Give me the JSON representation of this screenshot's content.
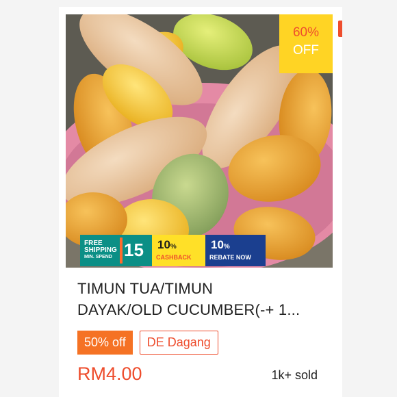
{
  "product": {
    "title_line1": "TIMUN TUA/TIMUN",
    "title_line2": "DAYAK/OLD CUCUMBER(-+ 1...",
    "price": "RM4.00",
    "sold": "1k+ sold",
    "image_alt": "Old cucumbers in a pink plastic basket"
  },
  "badge": {
    "percent": "60%",
    "off": "OFF"
  },
  "promo": {
    "shipping_line1": "FREE",
    "shipping_line2": "SHIPPING",
    "shipping_line3": "MIN. SPEND",
    "shipping_amount": "15",
    "cashback_value": "10",
    "cashback_label": "CASHBACK",
    "rebate_value": "10",
    "rebate_label": "REBATE NOW"
  },
  "tags": {
    "discount": "50% off",
    "shop": "DE Dagang"
  },
  "colors": {
    "accent": "#ee4d2d",
    "badge_yellow": "#ffd424",
    "discount_tag": "#f57224",
    "shipping_teal": "#0b8f86",
    "cashback_yellow": "#ffe028",
    "rebate_blue": "#1b3f8f"
  }
}
